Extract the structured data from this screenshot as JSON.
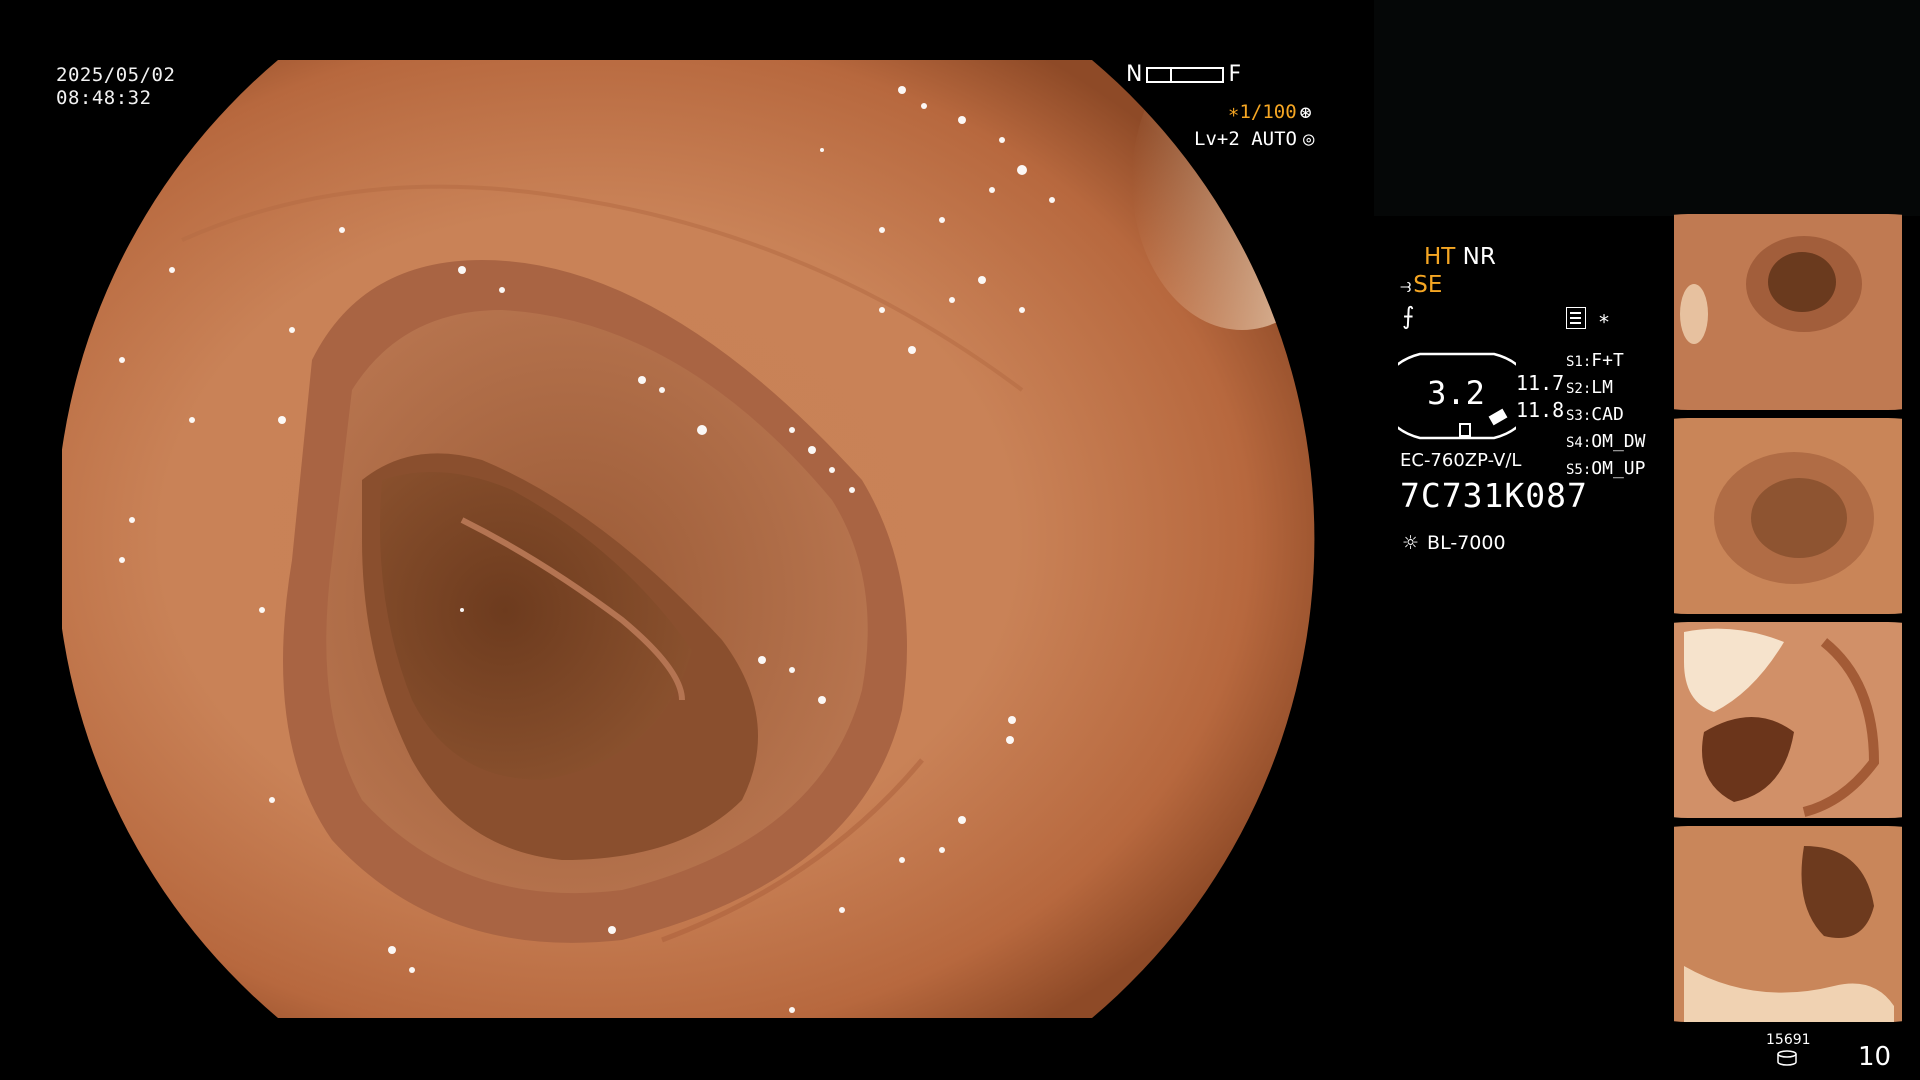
{
  "datetime": {
    "date": "2025/05/02",
    "time": "08:48:32"
  },
  "focus": {
    "near_label": "N",
    "far_label": "F"
  },
  "shutter": {
    "value": "∗1/100",
    "icon": "aperture-icon"
  },
  "enhance": {
    "value": "Lv+2 AUTO",
    "icon": "iris-icon"
  },
  "modes": {
    "ht": "HT",
    "nr": "NR",
    "se": "SE",
    "se_icon": "scope-icon",
    "zoom_icon": "zoom-icon"
  },
  "gauge": {
    "value": "3.2",
    "upper": "11.7",
    "lower": "11.8"
  },
  "record": {
    "icon": "record-icon",
    "star": "∗"
  },
  "settings": [
    {
      "key": "S1:",
      "value": "F+T"
    },
    {
      "key": "S2:",
      "value": "LM"
    },
    {
      "key": "S3:",
      "value": "CAD"
    },
    {
      "key": "S4:",
      "value": "OM_DW"
    },
    {
      "key": "S5:",
      "value": "OM_UP"
    }
  ],
  "scope": {
    "model": "EC-760ZP-V/L",
    "serial": "7C731K087"
  },
  "light_source": {
    "icon": "light-source-icon",
    "model": "BL-7000"
  },
  "storage": {
    "remaining": "15691",
    "icon": "disk-icon",
    "captured": "10"
  },
  "colors": {
    "accent": "#f5a623",
    "text": "#f2f2f2",
    "background": "#000000"
  }
}
